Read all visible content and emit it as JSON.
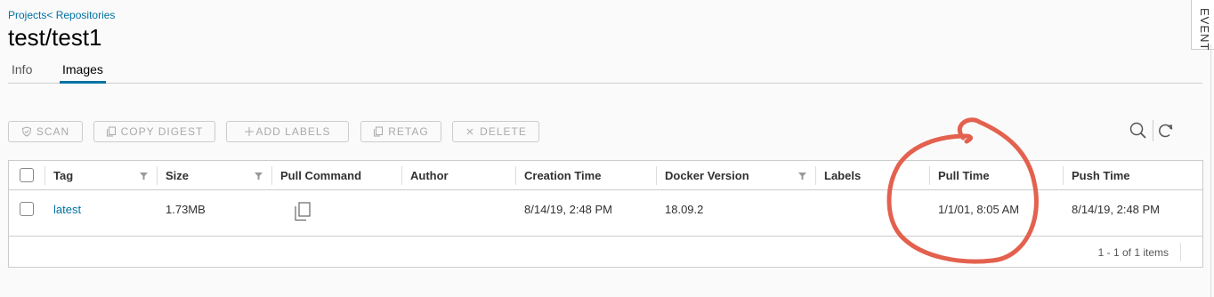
{
  "breadcrumb": {
    "projects": "Projects",
    "separator": "<",
    "repositories": "Repositories"
  },
  "page_title": "test/test1",
  "tabs": [
    {
      "label": "Info",
      "active": false
    },
    {
      "label": "Images",
      "active": true
    }
  ],
  "toolbar": {
    "scan": "SCAN",
    "copy_digest": "COPY DIGEST",
    "add_labels": "ADD LABELS",
    "retag": "RETAG",
    "delete": "DELETE"
  },
  "table": {
    "columns": [
      "Tag",
      "Size",
      "Pull Command",
      "Author",
      "Creation Time",
      "Docker Version",
      "Labels",
      "Pull Time",
      "Push Time"
    ],
    "rows": [
      {
        "tag": "latest",
        "size": "1.73MB",
        "pull_command_icon": "copy-icon",
        "author": "",
        "creation_time": "8/14/19, 2:48 PM",
        "docker_version": "18.09.2",
        "labels": "",
        "pull_time": "1/1/01, 8:05 AM",
        "push_time": "8/14/19, 2:48 PM"
      }
    ],
    "footer": "1 - 1 of 1 items"
  },
  "side_panel": {
    "label": "EVENT"
  },
  "colors": {
    "link": "#0072a3",
    "annotation": "#e3614e",
    "border": "#cccccc"
  }
}
